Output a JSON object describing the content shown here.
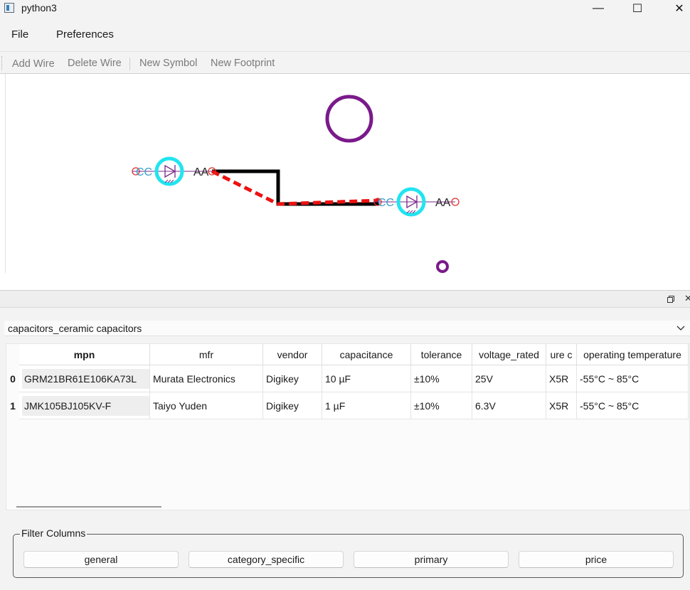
{
  "window": {
    "title": "python3",
    "minimize_glyph": "—",
    "maximize_glyph": "☐",
    "close_glyph": "✕"
  },
  "menubar": {
    "items": [
      {
        "label": "File"
      },
      {
        "label": "Preferences"
      }
    ]
  },
  "toolbar": {
    "add_wire": "Add Wire",
    "delete_wire": "Delete Wire",
    "new_symbol": "New Symbol",
    "new_footprint": "New Footprint"
  },
  "schematic": {
    "symbol_labels": {
      "left_c": "CC",
      "left_a": "AA",
      "right_c": "CC",
      "right_a": "AA"
    },
    "colors": {
      "wire_selected": "#ee1111",
      "wire": "#000000",
      "symbol_ring": "#22e4f0",
      "junction": "#7a1a8a",
      "pin_marker": "#e03030"
    }
  },
  "dock": {
    "float_icon": "restore-icon",
    "close_glyph": "✕"
  },
  "category_combo": {
    "value": "capacitors_ceramic capacitors"
  },
  "parts_table": {
    "columns": [
      "mpn",
      "mfr",
      "vendor",
      "capacitance",
      "tolerance",
      "voltage_rated",
      "ure c",
      "operating temperature"
    ],
    "rows": [
      {
        "index": "0",
        "mpn": "GRM21BR61E106KA73L",
        "mfr": "Murata Electronics",
        "vendor": "Digikey",
        "capacitance": "10 µF",
        "tolerance": "±10%",
        "voltage_rated": "25V",
        "dielectric": "X5R",
        "temperature": "-55°C ~ 85°C"
      },
      {
        "index": "1",
        "mpn": "JMK105BJ105KV-F",
        "mfr": "Taiyo Yuden",
        "vendor": "Digikey",
        "capacitance": "1 µF",
        "tolerance": "±10%",
        "voltage_rated": "6.3V",
        "dielectric": "X5R",
        "temperature": "-55°C ~ 85°C"
      }
    ]
  },
  "filter_columns": {
    "title": "Filter Columns",
    "buttons": [
      "general",
      "category_specific",
      "primary",
      "price"
    ]
  }
}
